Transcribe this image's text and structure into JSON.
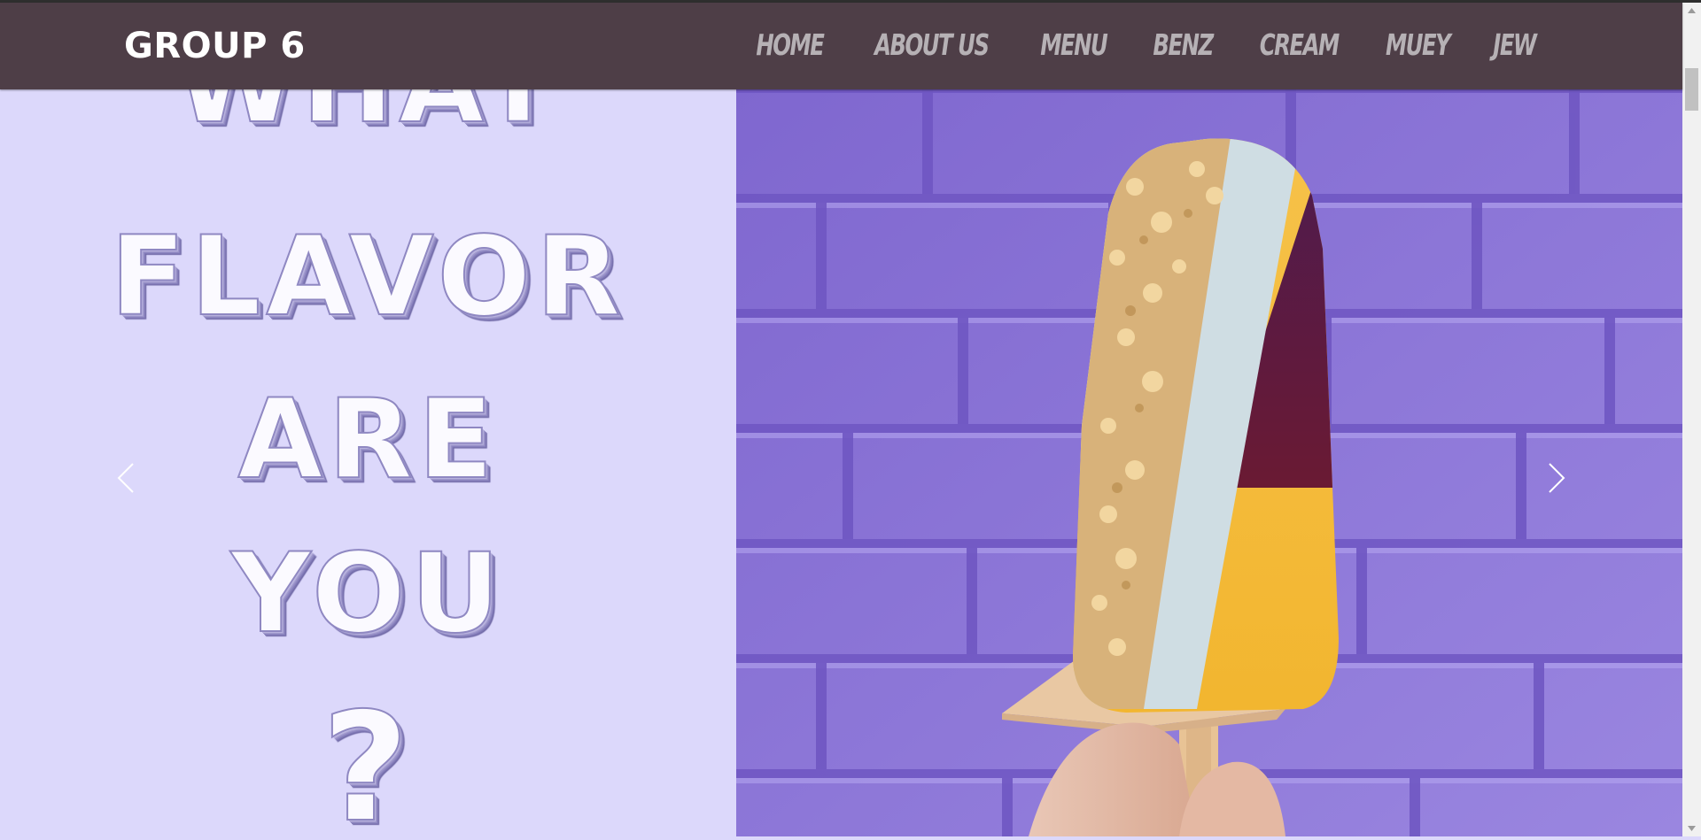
{
  "brand": {
    "label": "GROUP 6"
  },
  "nav": {
    "items": [
      {
        "label": "HOME"
      },
      {
        "label": "ABOUT US"
      },
      {
        "label": "MENU"
      },
      {
        "label": "BENZ"
      },
      {
        "label": "CREAM"
      },
      {
        "label": "MUEY"
      },
      {
        "label": "JEW"
      }
    ]
  },
  "hero": {
    "headline_lines": [
      "WHAT",
      "FLAVOR",
      "ARE",
      "YOU",
      "?"
    ],
    "prev_icon": "chevron-left-icon",
    "next_icon": "chevron-right-icon",
    "image_subject": "popsicle-photo"
  },
  "colors": {
    "navbar_bg": "#4e3e47",
    "nav_text": "#b6b1b5",
    "hero_left_bg": "#dcd8fb",
    "brick_wall": "#8a74d6"
  }
}
